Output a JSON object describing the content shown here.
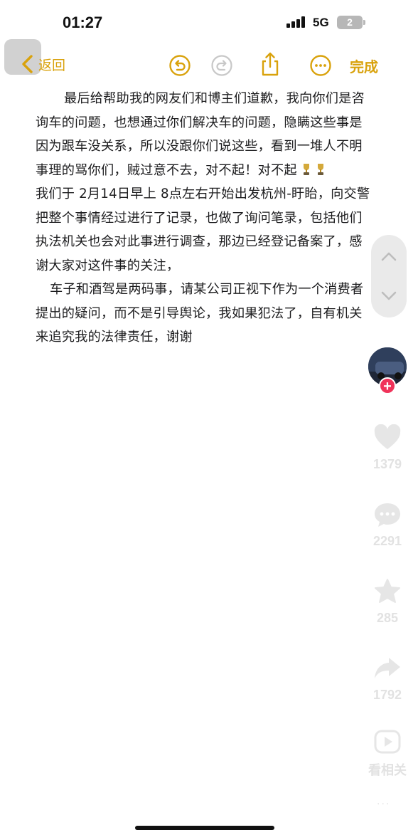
{
  "status_bar": {
    "time": "01:27",
    "network": "5G",
    "battery": "2"
  },
  "toolbar": {
    "back_label": "返回",
    "done_label": "完成"
  },
  "note": {
    "paragraph1": "最后给帮助我的网友们和博主们道歉，我向你们是咨询车的问题，也想通过你们解决车的问题，隐瞒这些事是因为跟车没关系，所以没跟你们说这些，看到一堆人不明事理的骂你们，贼过意不去，对不起！对不起",
    "paragraph2": "我们于 2月14日早上 8点左右开始出发杭州-盱眙，向交警把整个事情经过进行了记录，也做了询问笔录，包括他们执法机关也会对此事进行调查，那边已经登记备案了，感谢大家对这件事的关注，",
    "paragraph3": "车子和酒驾是两码事，请某公司正视下作为一个消费者提出的疑问，而不是引导舆论，我如果犯法了，自有机关来追究我的法律责任，谢谢"
  },
  "side_actions": {
    "likes": "1379",
    "comments": "2291",
    "favorites": "285",
    "shares": "1792",
    "related": "看相关"
  },
  "colors": {
    "accent": "#d9a20c",
    "follow": "#f0335a",
    "overlay_icon": "#e2e2e2"
  },
  "icons": [
    "chevron-left-icon",
    "undo-icon",
    "redo-icon",
    "share-icon",
    "more-icon",
    "trophy-emoji",
    "chevron-up-icon",
    "chevron-down-icon",
    "heart-icon",
    "comment-icon",
    "star-icon",
    "share-arrow-icon",
    "play-icon"
  ]
}
